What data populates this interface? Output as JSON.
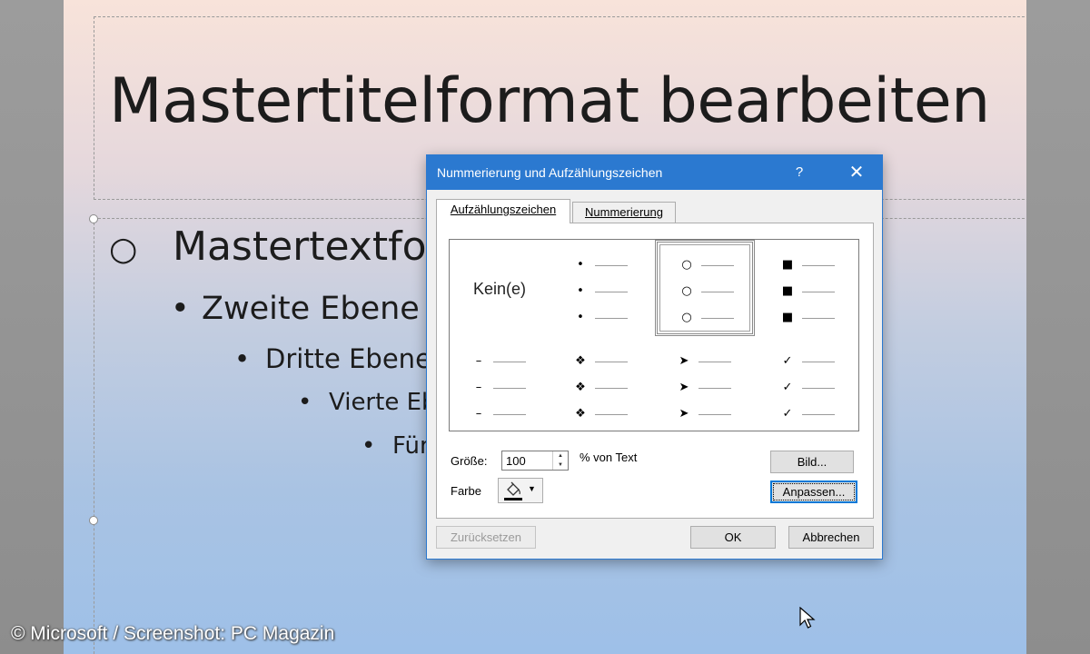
{
  "slide": {
    "title": "Mastertitelformat bearbeiten",
    "levels": [
      {
        "bullet": "○",
        "text": "Mastertextformat"
      },
      {
        "bullet": "•",
        "text": "Zweite Ebene"
      },
      {
        "bullet": "•",
        "text": "Dritte Ebene"
      },
      {
        "bullet": "•",
        "text": "Vierte Ebene"
      },
      {
        "bullet": "•",
        "text": "Fünfte Ebene"
      }
    ]
  },
  "watermark": "© Microsoft / Screenshot: PC Magazin",
  "dialog": {
    "title": "Nummerierung und Aufzählungszeichen",
    "help": "?",
    "close": "✕",
    "tabs": [
      {
        "label": "Aufzählungszeichen",
        "active": true
      },
      {
        "label": "Nummerierung",
        "active": false
      }
    ],
    "gallery": {
      "none_label": "Kein(e)",
      "cells": [
        {
          "id": "none"
        },
        {
          "glyph": "•",
          "icon": "bullet-small-dot"
        },
        {
          "glyph": "○",
          "icon": "bullet-hollow-circle",
          "selected": true
        },
        {
          "glyph": "■",
          "icon": "bullet-filled-square"
        },
        {
          "glyph": "–",
          "icon": "bullet-dash"
        },
        {
          "glyph": "❖",
          "icon": "bullet-diamond-four"
        },
        {
          "glyph": "➤",
          "icon": "bullet-arrowhead"
        },
        {
          "glyph": "✓",
          "icon": "bullet-checkmark"
        }
      ]
    },
    "size_label": "Größe:",
    "size_value": "100",
    "percent_label": "% von Text",
    "color_label": "Farbe",
    "picture_button": "Bild...",
    "customize_button": "Anpassen...",
    "reset_button": "Zurücksetzen",
    "ok_button": "OK",
    "cancel_button": "Abbrechen",
    "accent_color": "#2b79d0"
  }
}
